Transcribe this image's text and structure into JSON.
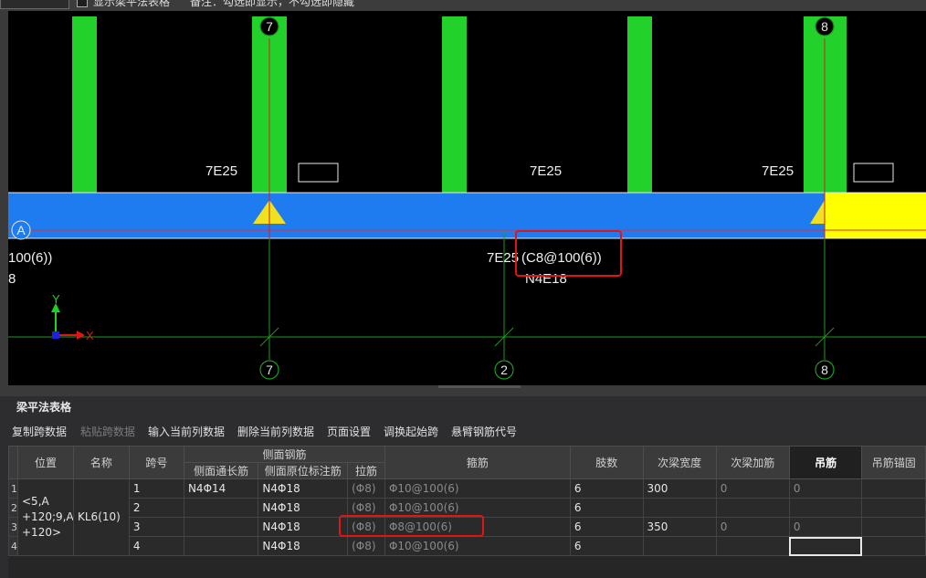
{
  "topbar": {
    "show_table_label": "显示梁平法表格",
    "note": "备注：勾选即显示，不勾选即隐藏"
  },
  "drawing": {
    "axis_labels": {
      "a7": "7",
      "a8": "8",
      "a2": "2",
      "aA": "A"
    },
    "rebar_labels": {
      "top1": "7E25",
      "top2": "7E25",
      "top3": "7E25"
    },
    "left_label_1": "100(6))",
    "left_label_2": "8",
    "center_label_prefix": "7E25",
    "center_label_main": "(C8@100(6))",
    "center_label_sub": "N4E18",
    "axis_y": "Y",
    "axis_x": "X"
  },
  "panel": {
    "title": "梁平法表格",
    "toolbar": [
      {
        "label": "复制跨数据",
        "enabled": true
      },
      {
        "label": "粘贴跨数据",
        "enabled": false
      },
      {
        "label": "输入当前列数据",
        "enabled": true
      },
      {
        "label": "删除当前列数据",
        "enabled": true
      },
      {
        "label": "页面设置",
        "enabled": true
      },
      {
        "label": "调换起始跨",
        "enabled": true
      },
      {
        "label": "悬臂钢筋代号",
        "enabled": true
      }
    ]
  },
  "table": {
    "headers": {
      "position": "位置",
      "name": "名称",
      "span": "跨号",
      "side_rebar": "侧面钢筋",
      "side_through": "侧面通长筋",
      "side_original": "侧面原位标注筋",
      "tie": "拉筋",
      "stirrup": "箍筋",
      "legs": "肢数",
      "sec_width": "次梁宽度",
      "sec_add": "次梁加筋",
      "hanger": "吊筋",
      "hanger_anchor": "吊筋锚固"
    },
    "position_value": "<5,A +120;9,A +120>",
    "name_value": "KL6(10)",
    "rows": [
      {
        "rownum": "1",
        "span": "1",
        "side_through": "N4Φ14",
        "side_original": "N4Φ18",
        "tie": "(Φ8)",
        "stirrup": "Φ10@100(6)",
        "legs": "6",
        "sec_width": "300",
        "sec_add": "0",
        "hanger": "0"
      },
      {
        "rownum": "2",
        "span": "2",
        "side_through": "",
        "side_original": "N4Φ18",
        "tie": "(Φ8)",
        "stirrup": "Φ10@100(6)",
        "legs": "6",
        "sec_width": "",
        "sec_add": "",
        "hanger": ""
      },
      {
        "rownum": "3",
        "span": "3",
        "side_through": "",
        "side_original": "N4Φ18",
        "tie": "(Φ8)",
        "stirrup": "Φ8@100(6)",
        "legs": "6",
        "sec_width": "350",
        "sec_add": "0",
        "hanger": "0"
      },
      {
        "rownum": "4",
        "span": "4",
        "side_through": "",
        "side_original": "N4Φ18",
        "tie": "(Φ8)",
        "stirrup": "Φ10@100(6)",
        "legs": "6",
        "sec_width": "",
        "sec_add": "",
        "hanger": ""
      }
    ]
  },
  "colors": {
    "column_green": "#22d22a",
    "beam_blue": "#1e7cf0",
    "beam_yellow": "#ffff00",
    "axis_line": "#1e9a1e",
    "highlight_red": "#e01515"
  }
}
